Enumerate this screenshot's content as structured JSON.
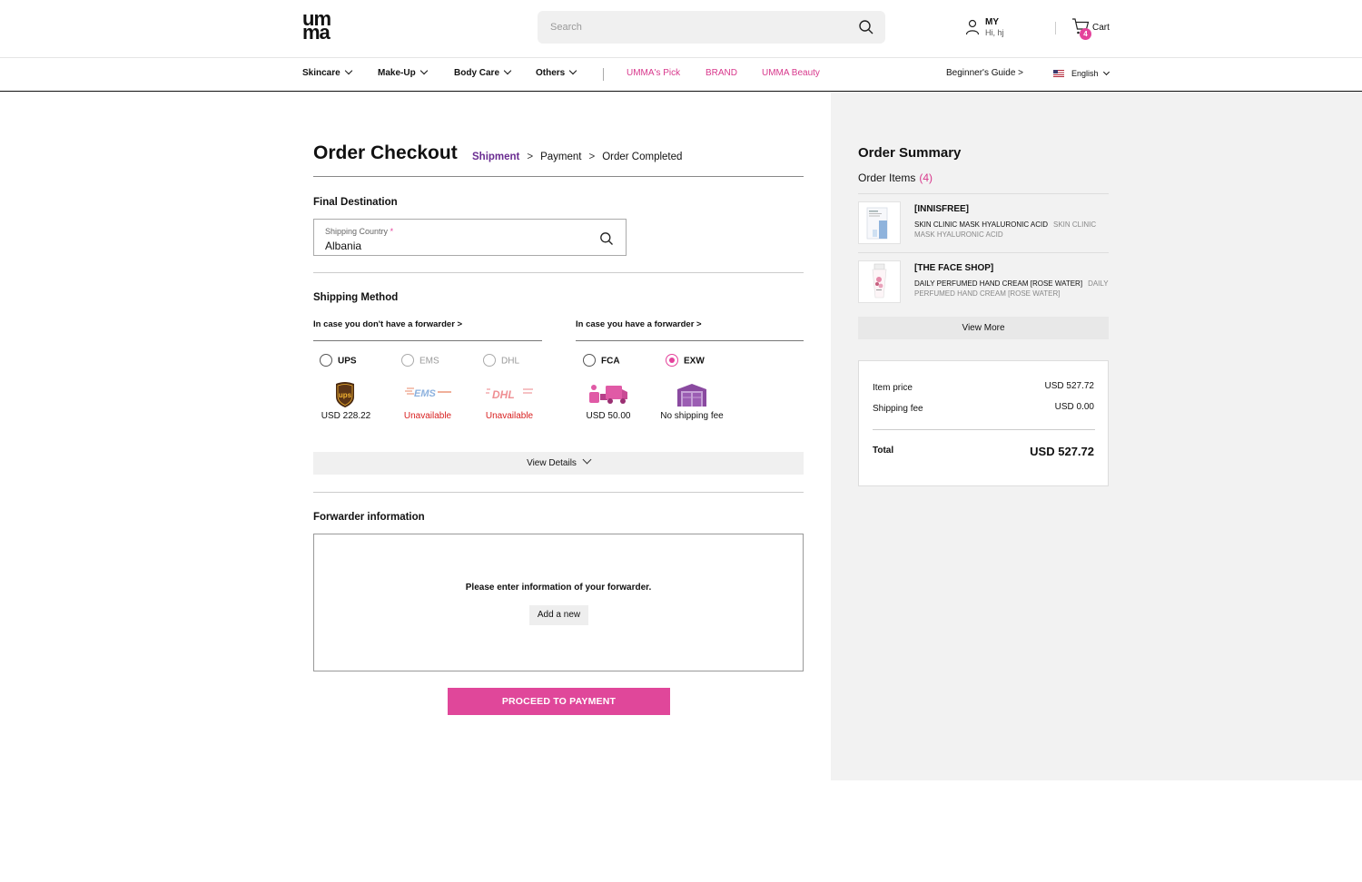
{
  "header": {
    "logo_top": "um",
    "logo_bottom": "ma",
    "search_placeholder": "Search",
    "my_label": "MY",
    "greeting": "Hi, hj",
    "cart_label": "Cart",
    "cart_count": "4"
  },
  "nav": {
    "categories": [
      "Skincare",
      "Make-Up",
      "Body Care",
      "Others"
    ],
    "featured": [
      "UMMA's Pick",
      "BRAND",
      "UMMA Beauty"
    ],
    "guide": "Beginner's Guide >",
    "language": "English"
  },
  "checkout": {
    "title": "Order Checkout",
    "steps": [
      "Shipment",
      "Payment",
      "Order Completed"
    ],
    "active_step": "Shipment",
    "final_destination": {
      "heading": "Final Destination",
      "field_label": "Shipping Country",
      "required_mark": "*",
      "value": "Albania"
    },
    "shipping_method": {
      "heading": "Shipping Method",
      "no_forwarder_heading": "In case you don't have a forwarder >",
      "forwarder_heading": "In case you have a forwarder >",
      "options": [
        {
          "label": "UPS",
          "price": "USD 228.22",
          "status": "available",
          "selected": false
        },
        {
          "label": "EMS",
          "price": "Unavailable",
          "status": "unavailable",
          "selected": false
        },
        {
          "label": "DHL",
          "price": "Unavailable",
          "status": "unavailable",
          "selected": false
        },
        {
          "label": "FCA",
          "price": "USD 50.00",
          "status": "available",
          "selected": false
        },
        {
          "label": "EXW",
          "price": "No shipping fee",
          "status": "available",
          "selected": true
        }
      ],
      "view_details": "View Details"
    },
    "forwarder": {
      "heading": "Forwarder information",
      "message": "Please enter information of your forwarder.",
      "add_button": "Add a new"
    },
    "proceed_button": "PROCEED TO PAYMENT"
  },
  "summary": {
    "title": "Order Summary",
    "items_label": "Order Items",
    "items_count": "(4)",
    "products": [
      {
        "brand": "[INNISFREE]",
        "name": "SKIN CLINIC MASK HYALURONIC ACID",
        "subname": "SKIN CLINIC MASK HYALURONIC ACID"
      },
      {
        "brand": "[THE FACE SHOP]",
        "name": "DAILY PERFUMED HAND CREAM [ROSE WATER]",
        "subname": "DAILY PERFUMED HAND CREAM [ROSE WATER]"
      }
    ],
    "view_more": "View More",
    "item_price_label": "Item price",
    "item_price": "USD 527.72",
    "shipping_fee_label": "Shipping fee",
    "shipping_fee": "USD 0.00",
    "total_label": "Total",
    "total": "USD 527.72"
  },
  "colors": {
    "accent_pink": "#e4429b",
    "step_active": "#6a2c91",
    "unavailable": "#d82020"
  }
}
